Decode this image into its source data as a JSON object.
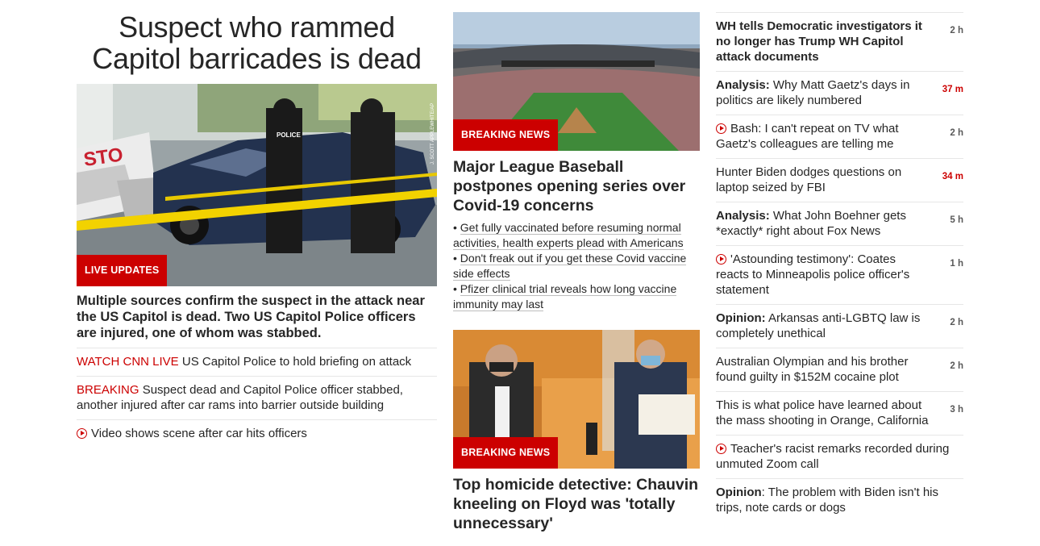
{
  "lead": {
    "headline": "Suspect who rammed Capitol barricades is dead",
    "badge": "LIVE UPDATES",
    "photo_credit": "J. SCOTT APPLEWHITE/AP",
    "summary": "Multiple sources confirm the suspect in the attack near the US Capitol is dead. Two US Capitol Police officers are injured, one of whom was stabbed.",
    "links": [
      {
        "label": "WATCH CNN LIVE",
        "text": " US Capitol Police to hold briefing on attack"
      },
      {
        "label": "BREAKING",
        "text": " Suspect dead and Capitol Police officer stabbed, another injured after car rams into barrier outside building"
      },
      {
        "video": true,
        "text": "Video shows scene after car hits officers"
      }
    ]
  },
  "story1": {
    "badge": "BREAKING NEWS",
    "headline": "Major League Baseball postpones opening series over Covid-19 concerns",
    "bullets": [
      "Get fully vaccinated before resuming normal activities, health experts plead with Americans",
      "Don't freak out if you get these Covid vaccine side effects",
      "Pfizer clinical trial reveals how long vaccine immunity may last"
    ]
  },
  "story2": {
    "badge": "BREAKING NEWS",
    "headline": "Top homicide detective: Chauvin kneeling on Floyd was 'totally unnecessary'"
  },
  "feed": [
    {
      "bold": "WH tells Democratic investigators it no longer has Trump WH Capitol attack documents",
      "text": "",
      "time": "2 h",
      "all_bold": true
    },
    {
      "bold": "Analysis:",
      "text": " Why Matt Gaetz's days in politics are likely numbered",
      "time": "37 m",
      "fresh": true
    },
    {
      "video": true,
      "text": "Bash: I can't repeat on TV what Gaetz's colleagues are telling me",
      "time": "2 h"
    },
    {
      "text": "Hunter Biden dodges questions on laptop seized by FBI",
      "time": "34 m",
      "fresh": true
    },
    {
      "bold": "Analysis:",
      "text": " What John Boehner gets *exactly* right about Fox News",
      "time": "5 h"
    },
    {
      "video": true,
      "text": "'Astounding testimony': Coates reacts to Minneapolis police officer's statement",
      "time": "1 h"
    },
    {
      "bold": "Opinion:",
      "text": " Arkansas anti-LGBTQ law is completely unethical",
      "time": "2 h"
    },
    {
      "text": "Australian Olympian and his brother found guilty in $152M cocaine plot",
      "time": "2 h"
    },
    {
      "text": "This is what police have learned about the mass shooting in Orange, California",
      "time": "3 h"
    },
    {
      "video": true,
      "text": "Teacher's racist remarks recorded during unmuted Zoom call",
      "time": ""
    },
    {
      "bold": "Opinion",
      "text": ": The problem with Biden isn't his trips, note cards or dogs",
      "time": ""
    }
  ],
  "colors": {
    "accent": "#cc0000",
    "text": "#262626",
    "divider": "#e6e6e6"
  }
}
